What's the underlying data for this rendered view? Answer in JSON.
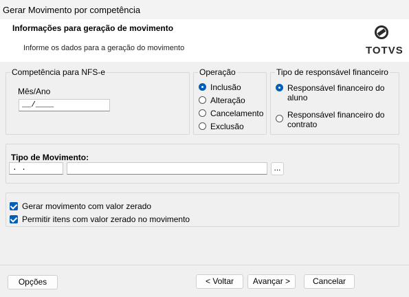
{
  "window": {
    "title": "Gerar Movimento por competência"
  },
  "header": {
    "title": "Informações para geração de movimento",
    "subtitle": "Informe os dados para a geração do movimento",
    "logo_text": "TOTVS"
  },
  "competencia": {
    "legend": "Competência para NFS-e",
    "field_label": "Mês/Ano",
    "value": "__/____"
  },
  "operacao": {
    "legend": "Operação",
    "options": [
      {
        "label": "Inclusão",
        "selected": true
      },
      {
        "label": "Alteração",
        "selected": false
      },
      {
        "label": "Cancelamento",
        "selected": false
      },
      {
        "label": "Exclusão",
        "selected": false
      }
    ]
  },
  "responsavel": {
    "legend": "Tipo de responsável financeiro",
    "options": [
      {
        "label_line1": "Responsável financeiro do",
        "label_line2": "aluno",
        "selected": true
      },
      {
        "label_line1": "Responsável financeiro do",
        "label_line2": "contrato",
        "selected": false
      }
    ]
  },
  "tipo_movimento": {
    "label": "Tipo de Movimento:",
    "code_value": ". .",
    "description_value": "",
    "lookup_label": "..."
  },
  "options": {
    "gerar_zerado": {
      "label": "Gerar movimento com valor zerado",
      "checked": true
    },
    "permitir_itens": {
      "label": "Permitir itens com valor zerado no movimento",
      "checked": true
    }
  },
  "buttons": {
    "opcoes": "Opções",
    "voltar": "< Voltar",
    "avancar": "Avançar >",
    "cancelar": "Cancelar"
  },
  "colors": {
    "accent": "#005fb8",
    "panel_bg": "#f0f0f0"
  }
}
